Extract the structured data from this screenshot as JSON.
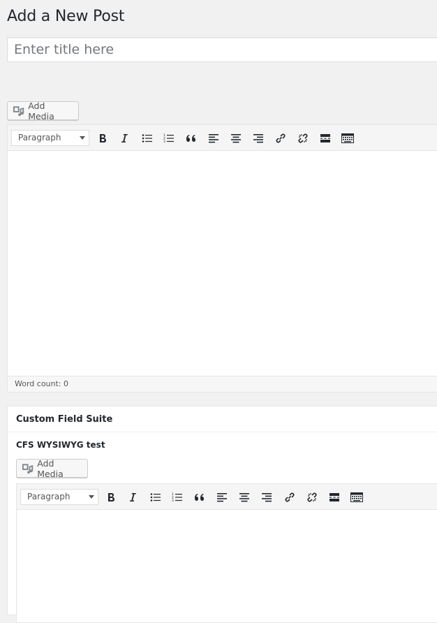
{
  "page": {
    "title": "Add a New Post"
  },
  "title_field": {
    "placeholder": "Enter title here",
    "value": ""
  },
  "main_editor": {
    "add_media_label": "Add Media",
    "format_select": "Paragraph",
    "word_count": "Word count: 0"
  },
  "cfs": {
    "box_title": "Custom Field Suite",
    "field_label": "CFS WYSIWYG test",
    "add_media_label": "Add Media",
    "format_select": "Paragraph"
  },
  "toolbar_icons": [
    "bold-icon",
    "italic-icon",
    "bulleted-list-icon",
    "numbered-list-icon",
    "blockquote-icon",
    "align-left-icon",
    "align-center-icon",
    "align-right-icon",
    "link-icon",
    "unlink-icon",
    "read-more-icon",
    "toolbar-toggle-icon"
  ],
  "colors": {
    "background": "#f1f1f1",
    "icon": "#23282d",
    "border": "#e5e5e5"
  }
}
